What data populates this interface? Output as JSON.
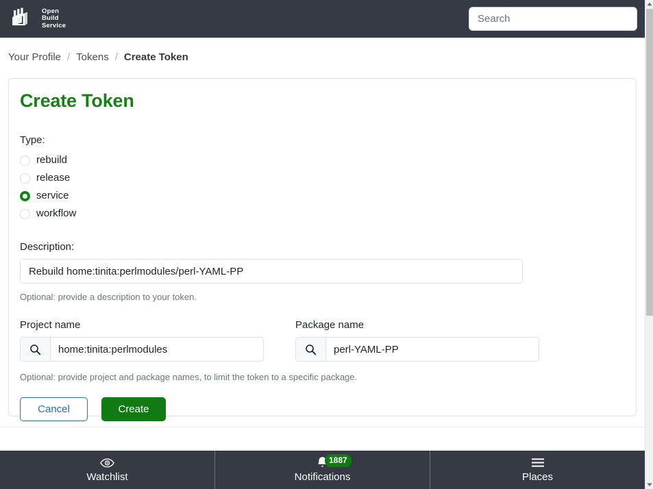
{
  "navbar": {
    "brand_name": "Open Build Service",
    "brand_lines": [
      "Open",
      "Build",
      "Service"
    ],
    "logo_icon": "factory-icon",
    "search": {
      "placeholder": "Search",
      "value": "",
      "icon": "search-icon"
    }
  },
  "breadcrumb": {
    "items": [
      {
        "label": "Your Profile",
        "active": false
      },
      {
        "label": "Tokens",
        "active": false
      },
      {
        "label": "Create Token",
        "active": true
      }
    ],
    "separator": "/"
  },
  "card": {
    "title": "Create Token",
    "title_color": "#1a7f1a",
    "type_label": "Type:",
    "type_options": [
      {
        "label": "rebuild",
        "selected": false
      },
      {
        "label": "release",
        "selected": false
      },
      {
        "label": "service",
        "selected": true
      },
      {
        "label": "workflow",
        "selected": false
      }
    ],
    "description": {
      "label": "Description:",
      "value": "Rebuild home:tinita:perlmodules/perl-YAML-PP",
      "placeholder": "",
      "help": "Optional: provide a description to your token."
    },
    "project": {
      "label": "Project name",
      "value": "home:tinita:perlmodules",
      "placeholder": "",
      "icon": "search-icon"
    },
    "package": {
      "label": "Package name",
      "value": "perl-YAML-PP",
      "placeholder": "",
      "icon": "search-icon"
    },
    "names_help": "Optional: provide project and package names, to limit the token to a specific package.",
    "buttons": {
      "cancel": "Cancel",
      "create": "Create"
    }
  },
  "footer": {
    "items": [
      {
        "label": "Watchlist",
        "icon": "eye-icon",
        "badge": ""
      },
      {
        "label": "Notifications",
        "icon": "bell-icon",
        "badge": "1887"
      },
      {
        "label": "Places",
        "icon": "hamburger-menu-icon",
        "badge": ""
      }
    ]
  },
  "colors": {
    "navbar_bg": "#353a45",
    "brand_green": "#1a7f1a",
    "create_green": "#127a12",
    "cancel_blue": "#2a6ca8",
    "badge_green": "#127a12"
  }
}
